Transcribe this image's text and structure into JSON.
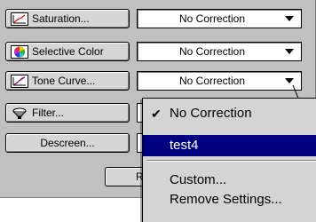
{
  "buttons": [
    {
      "label": "Saturation...",
      "icon": "saturation-icon"
    },
    {
      "label": "Selective Color",
      "icon": "selective-color-icon"
    },
    {
      "label": "Tone Curve...",
      "icon": "tone-curve-icon"
    },
    {
      "label": "Filter...",
      "icon": "filter-icon"
    },
    {
      "label": "Descreen...",
      "icon": ""
    }
  ],
  "selects": [
    {
      "value": "No Correction"
    },
    {
      "value": "No Correction"
    },
    {
      "value": "No Correction"
    }
  ],
  "bottom_button_label": "R",
  "menu": {
    "items": [
      {
        "label": "No Correction",
        "checked": true
      },
      {
        "label": "test4",
        "selected": true
      },
      {
        "label": "Custom..."
      },
      {
        "label": "Remove Settings..."
      }
    ]
  },
  "colors": {
    "panel": "#c0c0c0",
    "highlight": "#000080",
    "button_face": "#d6d6d6"
  }
}
